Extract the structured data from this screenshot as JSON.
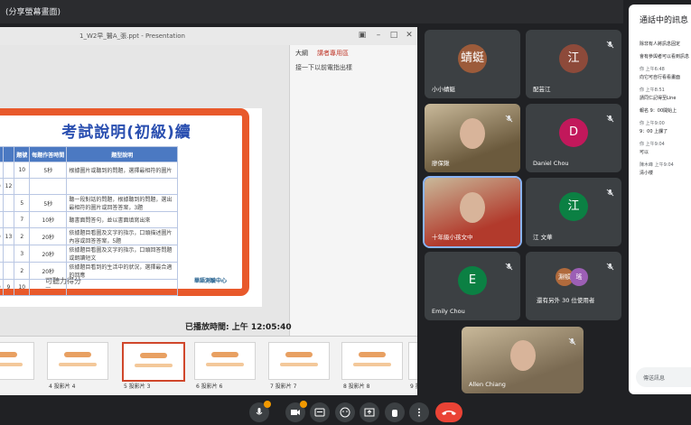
{
  "meet": {
    "window_title": "(分享螢幕畫面)"
  },
  "presentation": {
    "window_title": "1_W2早_醫A_張.ppt - Presentation",
    "side_tabs": [
      "大綱",
      "講者專用區"
    ],
    "side_note": "接一下以前電指出樣",
    "timer_label": "已播放時間: 上午 12:05:40",
    "slide": {
      "title": "考試說明(初級)續",
      "headers": [
        "",
        "",
        "題號",
        "時間",
        "第數",
        "每題作答時間",
        "題型說明"
      ],
      "rows": [
        [
          "",
          "",
          "10",
          "5秒",
          "根據圖片或聽到的問題，選擇最相符的圖片"
        ],
        [
          "30",
          "12",
          "",
          "",
          ""
        ],
        [
          "",
          "",
          "5",
          "5秒",
          "聽一段對話的問題，根據聽到的問題，選出最相符的圖片或回答答案，3題"
        ],
        [
          "",
          "",
          "7",
          "10秒",
          "聽書面問答句，並以書面填寫出來"
        ],
        [
          "50",
          "13",
          "2",
          "20秒",
          "依據題目看圖及文字的指示，口頭描述圖片內容或回答答案，5題"
        ],
        [
          "",
          "",
          "3",
          "20秒",
          "依據題目看圖及文字的指示，口頭回答問題或朗讀短文"
        ],
        [
          "",
          "",
          "2",
          "20秒",
          "依據題目看到的生活中的狀況，選擇最合適的回應"
        ],
        [
          "20",
          "9",
          "10",
          "—",
          ""
        ]
      ],
      "footer": "可聽力得分",
      "logo": "華語測驗中心"
    },
    "thumbnails": [
      {
        "label": "片 3"
      },
      {
        "label": "4 投影片 4"
      },
      {
        "label": "5 投影片 3"
      },
      {
        "label": "6 投影片 6"
      },
      {
        "label": "7 投影片 7"
      },
      {
        "label": "8 投影片 8"
      },
      {
        "label": "9 投影片"
      }
    ]
  },
  "participants": [
    {
      "name": "小小蜻蜓",
      "avatar_text": "蜻蜓",
      "avatar_color": "#9c5b3a",
      "muted": false
    },
    {
      "name": "配芸江",
      "avatar_text": "江",
      "avatar_color": "#8d4a3a",
      "muted": true
    },
    {
      "name": "廖保鍬",
      "avatar_text": "",
      "avatar_color": "#6b5a3d",
      "muted": true,
      "video": true
    },
    {
      "name": "Daniel Chou",
      "avatar_text": "D",
      "avatar_color": "#c2185b",
      "muted": true
    },
    {
      "name": "十年級小孩文中",
      "avatar_text": "",
      "avatar_color": "#b23a2c",
      "muted": false,
      "video": true,
      "speaking": true
    },
    {
      "name": "江 文華",
      "avatar_text": "江",
      "avatar_color": "#0b8043",
      "muted": true
    },
    {
      "name": "Emily Chou",
      "avatar_text": "E",
      "avatar_color": "#0b8043",
      "muted": true
    },
    {
      "name": "還有另外 30 位使用者",
      "avatar_text": "",
      "avatar_color": "#5f6368",
      "muted": true,
      "group": [
        "淵頓",
        "瑤"
      ]
    },
    {
      "name": "Allen Chiang",
      "avatar_text": "",
      "avatar_color": "#7a6a52",
      "muted": true,
      "video": true
    }
  ],
  "chat": {
    "title": "通話中的訊息",
    "messages": [
      {
        "name": "",
        "time": "",
        "text": "除非有人將訊息固定"
      },
      {
        "name": "",
        "time": "",
        "text": "會有參與者可以看到訊息"
      },
      {
        "name": "你",
        "time": "上午6:48",
        "text": "向它可自行看看畫面"
      },
      {
        "name": "你",
        "time": "上午8:51",
        "text": "請同仁記得至Line"
      },
      {
        "name": "",
        "time": "",
        "text": "報名 9：00開始上"
      },
      {
        "name": "你",
        "time": "上午9:00",
        "text": "9：00 上課了"
      },
      {
        "name": "你",
        "time": "上午9:04",
        "text": "可以"
      },
      {
        "name": "陳木峰",
        "time": "上午9:04",
        "text": "清小楼"
      }
    ],
    "input_placeholder": "傳送訊息"
  },
  "toolbar": {
    "buttons": [
      "mic-toggle",
      "camera-toggle",
      "captions",
      "emoji",
      "present",
      "raise-hand",
      "more",
      "leave-call"
    ]
  }
}
